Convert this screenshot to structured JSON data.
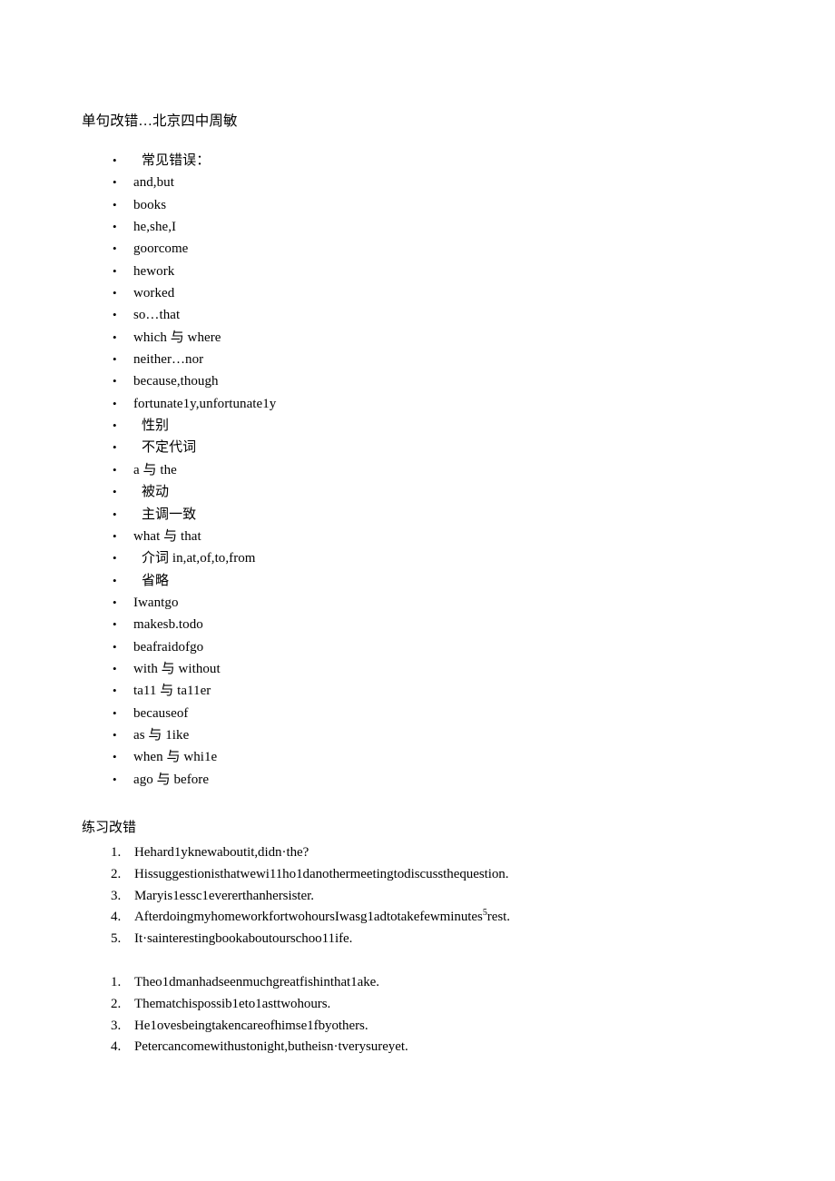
{
  "document": {
    "title": "单句改错…北京四中周敏",
    "section_heading": "练习改错"
  },
  "bullet_marker": "•",
  "bullets": [
    {
      "text": "常见错误：",
      "cjk_indent": true
    },
    {
      "text": "and,but",
      "cjk_indent": false
    },
    {
      "text": "books",
      "cjk_indent": false
    },
    {
      "text": "he,she,I",
      "cjk_indent": false
    },
    {
      "text": "goorcome",
      "cjk_indent": false
    },
    {
      "text": "hework",
      "cjk_indent": false
    },
    {
      "text": "worked",
      "cjk_indent": false
    },
    {
      "text": "so…that",
      "cjk_indent": false
    },
    {
      "text": "which 与 where",
      "cjk_indent": false
    },
    {
      "text": "neither…nor",
      "cjk_indent": false
    },
    {
      "text": "because,though",
      "cjk_indent": false
    },
    {
      "text": "fortunate1y,unfortunate1y",
      "cjk_indent": false
    },
    {
      "text": "性别",
      "cjk_indent": true
    },
    {
      "text": "不定代词",
      "cjk_indent": true
    },
    {
      "text": "a 与 the",
      "cjk_indent": false
    },
    {
      "text": "被动",
      "cjk_indent": true
    },
    {
      "text": "主调一致",
      "cjk_indent": true
    },
    {
      "text": "what 与 that",
      "cjk_indent": false
    },
    {
      "text": "介词 in,at,of,to,from",
      "cjk_indent": true
    },
    {
      "text": "省略",
      "cjk_indent": true
    },
    {
      "text": "Iwantgo",
      "cjk_indent": false
    },
    {
      "text": "makesb.todo",
      "cjk_indent": false
    },
    {
      "text": "beafraidofgo",
      "cjk_indent": false
    },
    {
      "text": "with 与 without",
      "cjk_indent": false
    },
    {
      "text": "ta11 与 ta11er",
      "cjk_indent": false
    },
    {
      "text": "becauseof",
      "cjk_indent": false
    },
    {
      "text": "as 与 1ike",
      "cjk_indent": false
    },
    {
      "text": "when 与 whi1e",
      "cjk_indent": false
    },
    {
      "text": "ago 与 before",
      "cjk_indent": false
    }
  ],
  "exercise_list_one": [
    {
      "number": "1.",
      "text": "Hehard1yknewaboutit,didn·the?"
    },
    {
      "number": "2.",
      "text": "Hissuggestionisthatwewi11ho1danothermeetingtodiscussthequestion."
    },
    {
      "number": "3.",
      "text": "Maryis1essc1evererthanhersister."
    },
    {
      "number": "4.",
      "text": "AfterdoingmyhomeworkfortwohoursIwasg1adtotakefewminutes",
      "superscript": "5",
      "text_after": "rest."
    },
    {
      "number": "5.",
      "text": "It·sainterestingbookaboutourschoo11ife."
    }
  ],
  "exercise_list_two": [
    {
      "number": "1.",
      "text": "Theo1dmanhadseenmuchgreatfishinthat1ake."
    },
    {
      "number": "2.",
      "text": "Thematchispossib1eto1asttwohours."
    },
    {
      "number": "3.",
      "text": "He1ovesbeingtakencareofhimse1fbyothers."
    },
    {
      "number": "4.",
      "text": "Petercancomewithustonight,butheisn·tverysureyet."
    }
  ],
  "colors": {
    "page_background": "#ffffff",
    "text": "#000000"
  }
}
